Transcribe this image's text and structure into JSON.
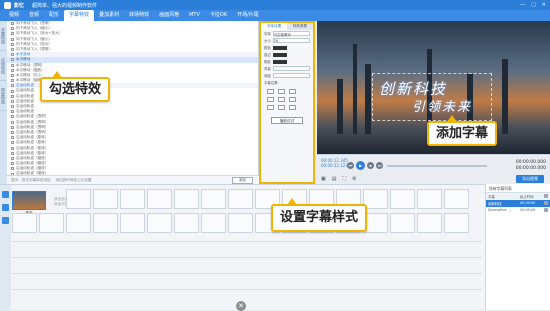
{
  "titlebar": {
    "app_name": "影忆",
    "subtitle": "超简单、强大的视频制作软件",
    "win_controls": [
      "—",
      "□",
      "✕"
    ]
  },
  "menubar": {
    "tabs": [
      "视频",
      "音频",
      "配乐",
      "字幕特效",
      "叠加素材",
      "转场特效",
      "画面风格",
      "MTV",
      "卡拉OK",
      "开场/片尾"
    ],
    "active": "字幕特效"
  },
  "leftrail": {
    "items": [
      "字幕特效",
      "出场特效",
      "停留特效"
    ]
  },
  "effects_list": {
    "rows": [
      {
        "label": "向下滚动飞入（透明）",
        "type": "item"
      },
      {
        "label": "向下滚动飞入（缩小）",
        "type": "item"
      },
      {
        "label": "向下滚动飞入（放大+放大）",
        "type": "item"
      },
      {
        "label": "向下滚动飞入（缩小）",
        "type": "item"
      },
      {
        "label": "向下滚动飞入（放大）",
        "type": "item"
      },
      {
        "label": "向下滚动飞入（透明）",
        "type": "item"
      },
      {
        "label": "水平波动",
        "type": "grp"
      },
      {
        "label": "水平移动",
        "type": "sel"
      },
      {
        "label": "水平移动（透明）",
        "type": "item"
      },
      {
        "label": "水平移动（缩放）",
        "type": "item"
      },
      {
        "label": "水平移动（向上）",
        "type": "item"
      },
      {
        "label": "水平移动（旋转）",
        "type": "item"
      },
      {
        "label": "沿运动轨迹",
        "type": "grp"
      },
      {
        "label": "沿运动轨迹",
        "type": "item"
      },
      {
        "label": "沿运动轨迹",
        "type": "item"
      },
      {
        "label": "沿运动轨迹",
        "type": "item"
      },
      {
        "label": "沿运动轨迹",
        "type": "item"
      },
      {
        "label": "沿运动轨迹",
        "type": "item"
      },
      {
        "label": "沿运动轨迹（透明）",
        "type": "item"
      },
      {
        "label": "沿运动轨迹（透明）",
        "type": "item"
      },
      {
        "label": "沿运动轨迹（透明）",
        "type": "item"
      },
      {
        "label": "沿运动轨迹（透明）",
        "type": "item"
      },
      {
        "label": "沿运动轨迹（旋转）",
        "type": "item"
      },
      {
        "label": "沿运动轨迹（旋转）",
        "type": "item"
      },
      {
        "label": "沿运动轨迹（旋转）",
        "type": "item"
      },
      {
        "label": "沿运动轨迹（旋转）",
        "type": "item"
      },
      {
        "label": "沿运动轨迹（缩放）",
        "type": "item"
      },
      {
        "label": "沿运动轨迹（缩放）",
        "type": "item"
      },
      {
        "label": "沿运动轨迹（缩放）",
        "type": "item"
      },
      {
        "label": "沿运动轨迹（缩放）",
        "type": "item"
      }
    ],
    "footer": {
      "hint1": "提示：双击字幕特效添加",
      "hint2": "添加到时间线上并设置",
      "button": "添加"
    }
  },
  "settings": {
    "tabs": [
      "字体设置",
      "特效参数"
    ],
    "rows": [
      "字体",
      "大小",
      "颜色",
      "描边",
      "阴影",
      "透明度",
      "对齐"
    ],
    "field_labels": {
      "font": "字体",
      "size": "大小",
      "color": "颜色"
    },
    "font_value": "方正粗黑宋",
    "size_value": "28",
    "extra_labels": [
      "描边",
      "阴影",
      "背景",
      "间距"
    ],
    "position_label": "字幕位置：",
    "apply_label": "播放试试"
  },
  "preview": {
    "subtitle_line1": "创新科技",
    "subtitle_line2": "引领未来"
  },
  "controls": {
    "time_current": "00:00:12.345",
    "time_total": "00:00:32.123",
    "time_right_top": "00:00:00.000",
    "time_right_bottom": "00:00:00.000",
    "buttons": [
      "⏮",
      "▶",
      "⏹",
      "⏭"
    ],
    "export_label": "导出视频"
  },
  "timeline": {
    "clip_label": "城市",
    "hint_line1": "双击此处",
    "hint_line2": "添加字幕"
  },
  "rightpanel": {
    "title": "所有字幕列表",
    "headers": [
      "字幕",
      "起止时间"
    ],
    "rows": [
      {
        "name": "创新科技",
        "time": "00:00:00",
        "sel": true
      },
      {
        "name": "Decorative ...",
        "time": "00:00:00",
        "sel": false
      }
    ]
  },
  "callouts": {
    "select_effect": "勾选特效",
    "add_subtitle": "添加字幕",
    "set_style": "设置字幕样式"
  },
  "colors": {
    "accent": "#2c7fd9",
    "callout_border": "#f2b400"
  }
}
